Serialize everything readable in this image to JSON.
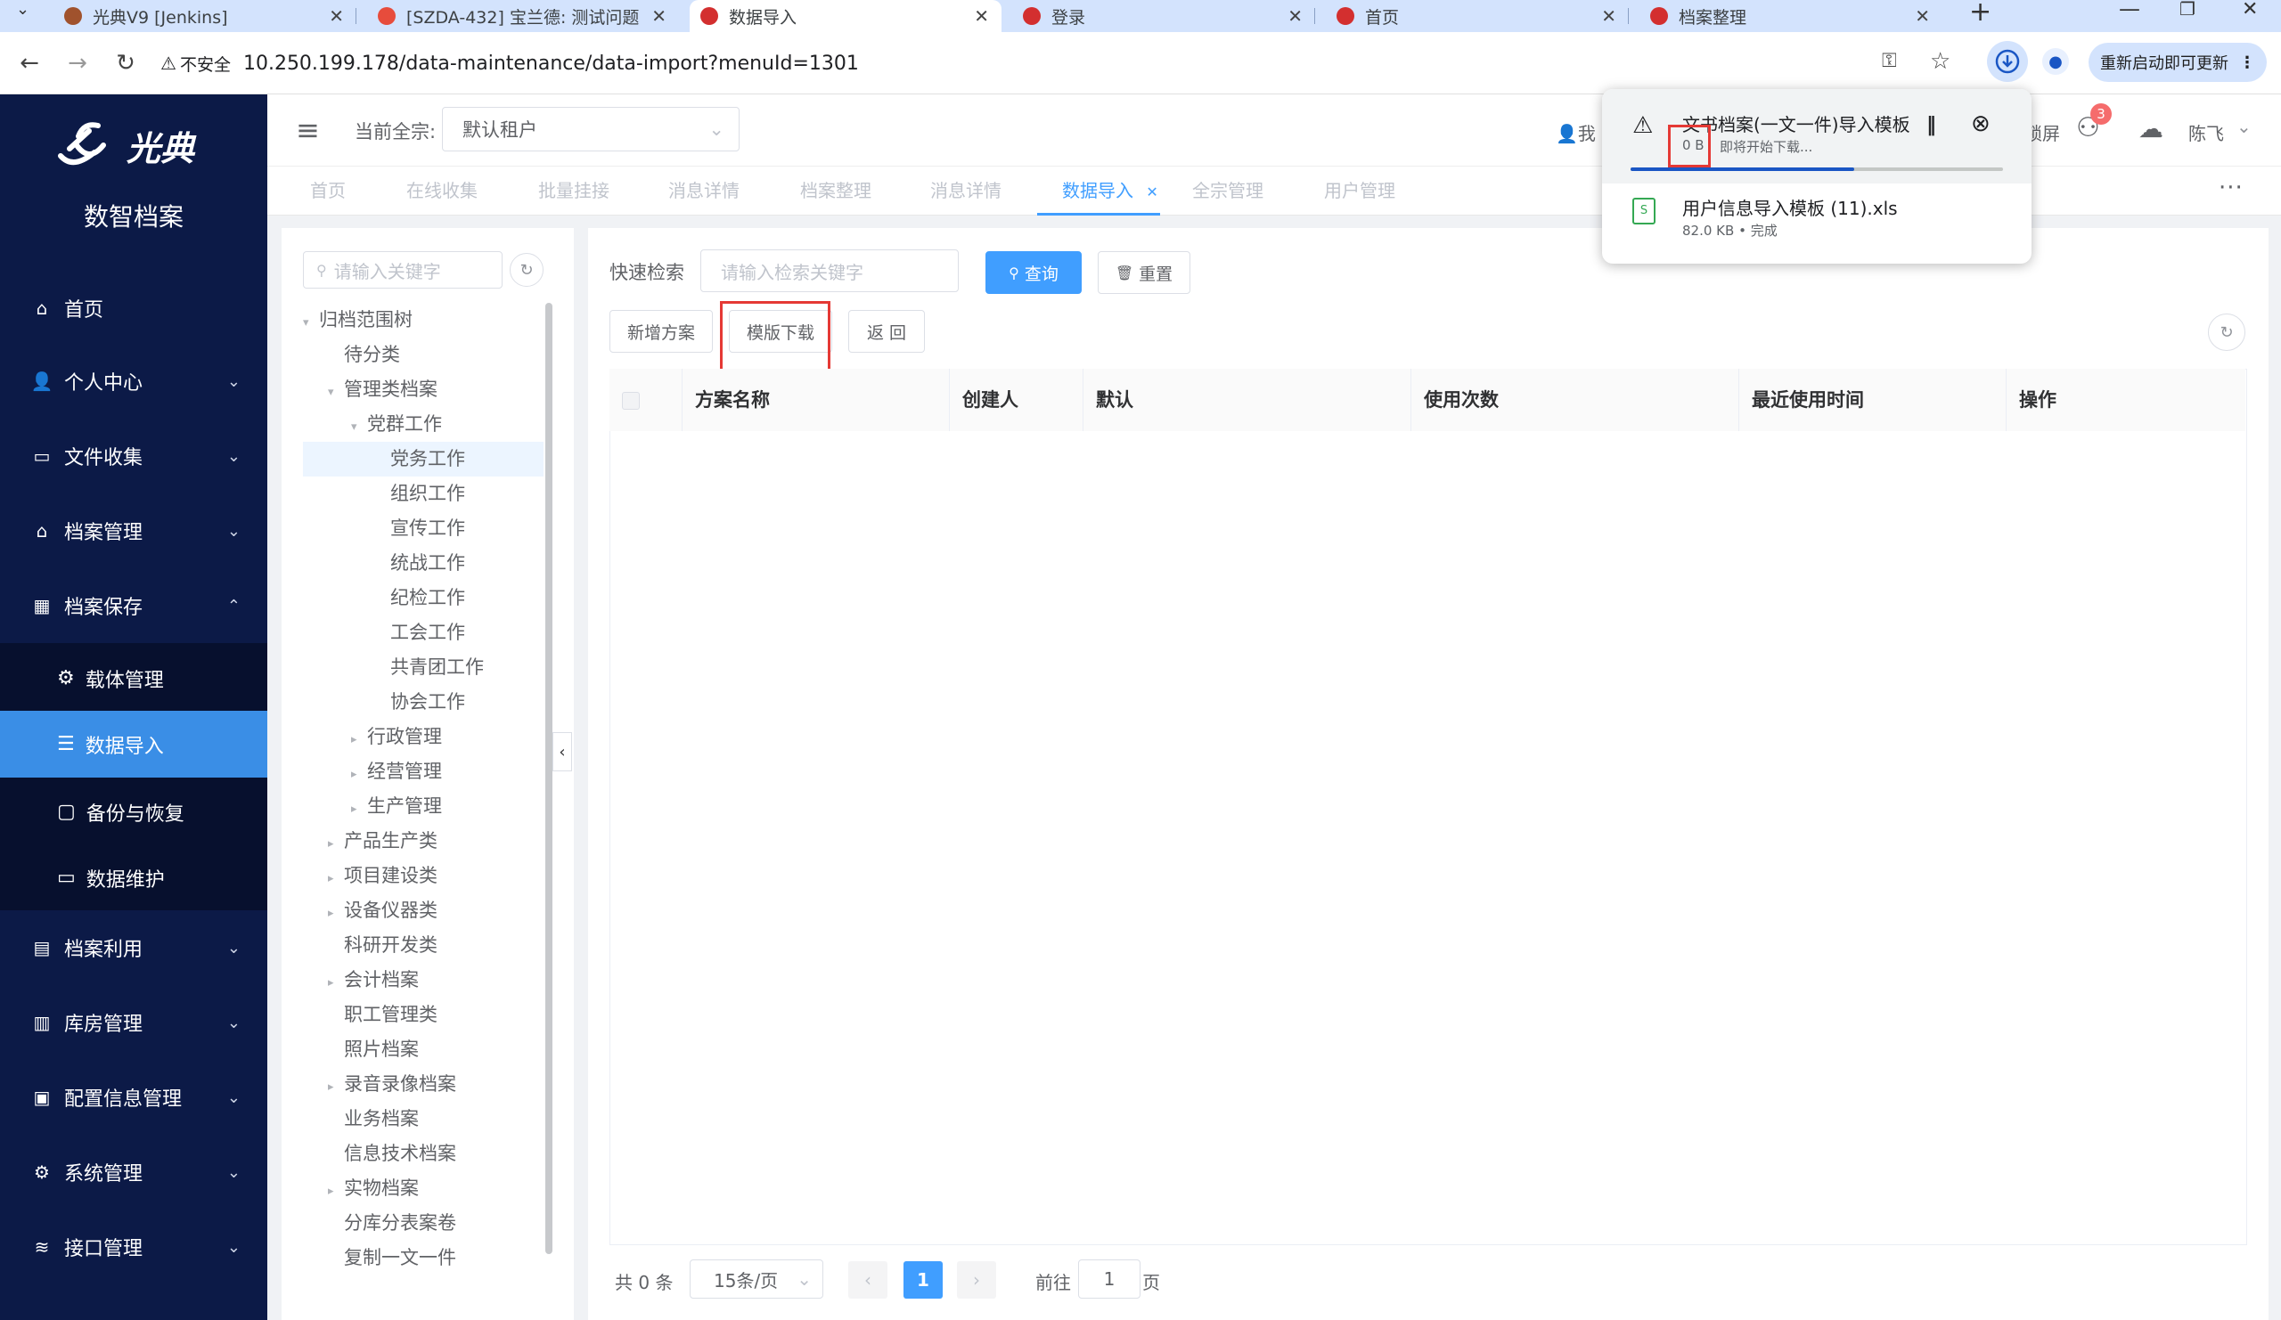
{
  "browser": {
    "tabs": [
      {
        "label": "光典V9 [Jenkins]",
        "fav": "#a0522d"
      },
      {
        "label": "[SZDA-432] 宝兰德: 测试问题",
        "fav": "#e74c3c"
      },
      {
        "label": "数据导入",
        "fav": "#d32f2f"
      },
      {
        "label": "登录",
        "fav": "#d32f2f"
      },
      {
        "label": "首页",
        "fav": "#d32f2f"
      },
      {
        "label": "档案整理",
        "fav": "#d32f2f"
      }
    ],
    "insecure_label": "不安全",
    "url": "10.250.199.178/data-maintenance/data-import?menuId=1301",
    "update_button": "重新启动即可更新"
  },
  "sidebar": {
    "logo_text": "光典",
    "app_name": "数智档案",
    "items": [
      {
        "label": "首页",
        "icon": "home-icon"
      },
      {
        "label": "个人中心",
        "icon": "user-icon"
      },
      {
        "label": "文件收集",
        "icon": "briefcase-icon"
      },
      {
        "label": "档案管理",
        "icon": "bank-icon"
      },
      {
        "label": "档案保存",
        "icon": "building-icon"
      }
    ],
    "subitems": [
      {
        "label": "载体管理",
        "icon": "chip-icon"
      },
      {
        "label": "数据导入",
        "icon": "database-icon"
      },
      {
        "label": "备份与恢复",
        "icon": "backup-icon"
      },
      {
        "label": "数据维护",
        "icon": "folder-icon"
      }
    ],
    "items_after": [
      {
        "label": "档案利用",
        "icon": "clipboard-icon"
      },
      {
        "label": "库房管理",
        "icon": "warehouse-icon"
      },
      {
        "label": "配置信息管理",
        "icon": "calendar-icon"
      },
      {
        "label": "系统管理",
        "icon": "gear-icon"
      },
      {
        "label": "接口管理",
        "icon": "stack-icon"
      }
    ]
  },
  "header": {
    "current_label": "当前全宗:",
    "tenant": "默认租户",
    "user_partial": "我",
    "lock_partial": "锁屏",
    "badge": "3",
    "user_name": "陈飞"
  },
  "page_tabs": [
    "首页",
    "在线收集",
    "批量挂接",
    "消息详情",
    "档案整理",
    "消息详情",
    "数据导入",
    "全宗管理",
    "用户管理"
  ],
  "tree": {
    "search_placeholder": "请输入关键字",
    "nodes": [
      {
        "label": "归档范围树",
        "depth": 0,
        "arrow": "open"
      },
      {
        "label": "待分类",
        "depth": 1,
        "arrow": ""
      },
      {
        "label": "管理类档案",
        "depth": 1,
        "arrow": "open"
      },
      {
        "label": "党群工作",
        "depth": 2,
        "arrow": "open"
      },
      {
        "label": "党务工作",
        "depth": 3,
        "arrow": "",
        "selected": true
      },
      {
        "label": "组织工作",
        "depth": 3,
        "arrow": ""
      },
      {
        "label": "宣传工作",
        "depth": 3,
        "arrow": ""
      },
      {
        "label": "统战工作",
        "depth": 3,
        "arrow": ""
      },
      {
        "label": "纪检工作",
        "depth": 3,
        "arrow": ""
      },
      {
        "label": "工会工作",
        "depth": 3,
        "arrow": ""
      },
      {
        "label": "共青团工作",
        "depth": 3,
        "arrow": ""
      },
      {
        "label": "协会工作",
        "depth": 3,
        "arrow": ""
      },
      {
        "label": "行政管理",
        "depth": 2,
        "arrow": "closed"
      },
      {
        "label": "经营管理",
        "depth": 2,
        "arrow": "closed"
      },
      {
        "label": "生产管理",
        "depth": 2,
        "arrow": "closed"
      },
      {
        "label": "产品生产类",
        "depth": 1,
        "arrow": "closed"
      },
      {
        "label": "项目建设类",
        "depth": 1,
        "arrow": "closed"
      },
      {
        "label": "设备仪器类",
        "depth": 1,
        "arrow": "closed"
      },
      {
        "label": "科研开发类",
        "depth": 1,
        "arrow": ""
      },
      {
        "label": "会计档案",
        "depth": 1,
        "arrow": "closed"
      },
      {
        "label": "职工管理类",
        "depth": 1,
        "arrow": ""
      },
      {
        "label": "照片档案",
        "depth": 1,
        "arrow": ""
      },
      {
        "label": "录音录像档案",
        "depth": 1,
        "arrow": "closed"
      },
      {
        "label": "业务档案",
        "depth": 1,
        "arrow": ""
      },
      {
        "label": "信息技术档案",
        "depth": 1,
        "arrow": ""
      },
      {
        "label": "实物档案",
        "depth": 1,
        "arrow": "closed"
      },
      {
        "label": "分库分表案卷",
        "depth": 1,
        "arrow": ""
      },
      {
        "label": "复制一文一件",
        "depth": 1,
        "arrow": ""
      }
    ]
  },
  "main": {
    "search_label": "快速检索",
    "search_placeholder": "请输入检索关键字",
    "query_button": "查询",
    "reset_button": "重置",
    "add_button": "新增方案",
    "template_button": "模版下载",
    "back_button": "返 回",
    "columns": [
      "方案名称",
      "创建人",
      "默认",
      "使用次数",
      "最近使用时间",
      "操作"
    ],
    "rows": [],
    "total": "共 0 条",
    "page_size": "15条/页",
    "current_page": "1",
    "goto_label": "前往",
    "goto_value": "1",
    "page_unit": "页"
  },
  "downloads": {
    "items": [
      {
        "name": "文书档案(一文一件)导入模板",
        "size": "0 B",
        "status": "即将开始下载...",
        "progress": 0.6
      },
      {
        "name": "用户信息导入模板 (11).xls",
        "size": "82.0 KB",
        "status": "完成"
      }
    ],
    "size_status_sep": " • "
  },
  "colors": {
    "sidebar": "#0c1a47",
    "sidebar_active": "#3a8ee6",
    "primary": "#409eff",
    "highlight_box": "#e53935"
  }
}
